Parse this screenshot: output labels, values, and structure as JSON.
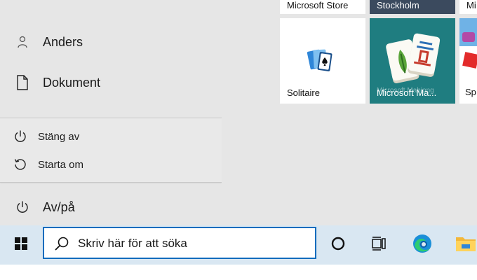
{
  "start_menu": {
    "items": [
      {
        "label": "Anders",
        "icon": "person-icon"
      },
      {
        "label": "Dokument",
        "icon": "document-icon"
      }
    ],
    "power_submenu": [
      {
        "label": "Stäng av",
        "icon": "power-icon"
      },
      {
        "label": "Starta om",
        "icon": "restart-icon"
      }
    ],
    "power_item": {
      "label": "Av/på",
      "icon": "power-icon"
    }
  },
  "tiles": {
    "microsoft_store": {
      "label": "Microsoft Store"
    },
    "weather": {
      "label": "Stockholm"
    },
    "solitaire": {
      "label": "Solitaire"
    },
    "mahjong": {
      "label": "Microsoft Ma...",
      "overlay_text": "Microsoft Mahjong"
    },
    "partial_top": {
      "label": "Mi"
    },
    "partial_game": {
      "label": "Sp"
    }
  },
  "taskbar": {
    "search_placeholder": "Skriv här för att söka",
    "icons": [
      "windows-logo-icon",
      "search-icon",
      "cortana-icon",
      "task-view-icon",
      "edge-icon",
      "file-explorer-icon"
    ]
  },
  "colors": {
    "menu_bg": "#e6e6e6",
    "taskbar_bg": "#d9e7f2",
    "accent": "#0f6cbd",
    "weather_tile": "#3b4a5e",
    "mahjong_tile": "#1f7d80"
  }
}
